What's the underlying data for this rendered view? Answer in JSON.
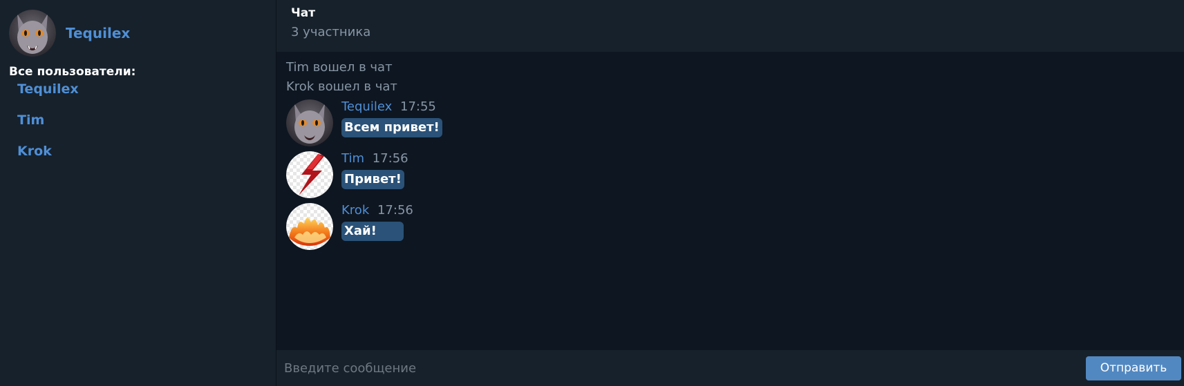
{
  "current_user": {
    "name": "Tequilex",
    "avatar": "cat-avatar"
  },
  "sidebar": {
    "users_title": "Все пользователи:",
    "users": [
      {
        "name": "Tequilex"
      },
      {
        "name": "Tim"
      },
      {
        "name": "Krok"
      }
    ]
  },
  "chat": {
    "title": "Чат",
    "subtitle": "3 участника"
  },
  "system_messages": [
    "Tim вошел в чат",
    "Krok вошел в чат"
  ],
  "messages": [
    {
      "author": "Tequilex",
      "time": "17:55",
      "text": "Всем привет!",
      "avatar": "cat-avatar"
    },
    {
      "author": "Tim",
      "time": "17:56",
      "text": "Привет!",
      "avatar": "lightning-avatar"
    },
    {
      "author": "Krok",
      "time": "17:56",
      "text": "Хай!",
      "avatar": "fire-avatar"
    }
  ],
  "composer": {
    "placeholder": "Введите сообщение",
    "send_label": "Отправить"
  },
  "colors": {
    "sidebar_bg": "#17212b",
    "chat_bg": "#0e1621",
    "accent": "#4f8fd6",
    "bubble": "#2b5278",
    "button": "#5288c1"
  }
}
